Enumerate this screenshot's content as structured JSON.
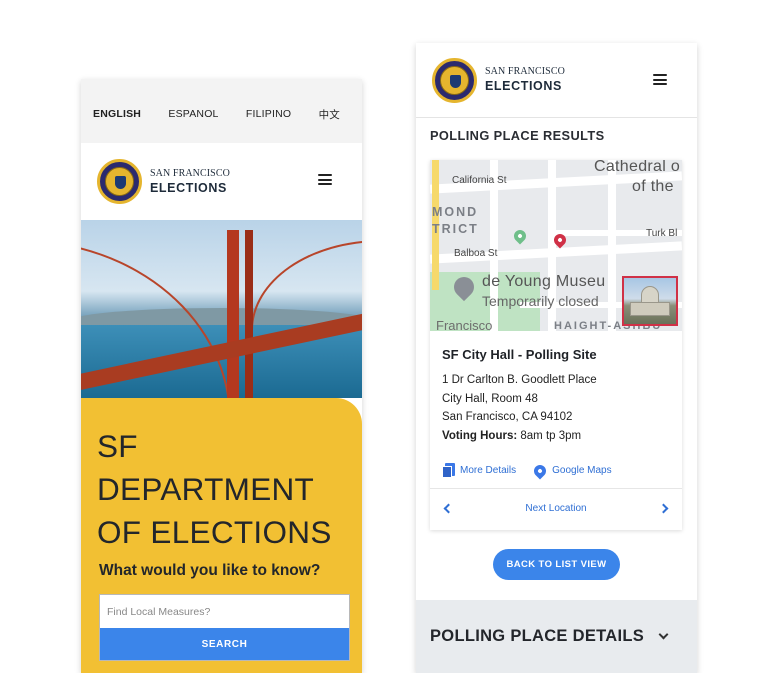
{
  "languages": [
    "ENGLISH",
    "ESPANOL",
    "FILIPINO",
    "中文"
  ],
  "brand": {
    "line1": "SAN FRANCISCO",
    "line2": "ELECTIONS"
  },
  "home": {
    "title": "SF DEPARTMENT OF ELECTIONS",
    "subtitle": "What would you like to know?",
    "search_placeholder": "Find Local Measures?",
    "search_button": "SEARCH"
  },
  "results": {
    "title": "POLLING PLACE RESULTS",
    "map_labels": {
      "california_st": "California St",
      "cathedral": "Cathedral o",
      "of_the": "of the",
      "district1": "MOND",
      "district2": "TRICT",
      "turk": "Turk Bl",
      "balboa": "Balboa St",
      "museum": "de Young Museu",
      "closed": "Temporarily closed",
      "francisco": "Francisco",
      "haight": "HAIGHT-ASHBU"
    },
    "site_name": "SF City Hall - Polling Site",
    "address": [
      "1 Dr Carlton B. Goodlett Place",
      "City Hall, Room 48",
      "San Francisco, CA 94102"
    ],
    "hours_label": "Voting Hours:",
    "hours_value": "8am tp 3pm",
    "more_details": "More Details",
    "google_maps": "Google Maps",
    "next_location": "Next Location",
    "back_button": "BACK TO LIST VIEW",
    "details_header": "POLLING PLACE DETAILS"
  },
  "colors": {
    "accent_blue": "#3b85ea",
    "panel_yellow": "#f2c033",
    "pin_red": "#d03147"
  }
}
